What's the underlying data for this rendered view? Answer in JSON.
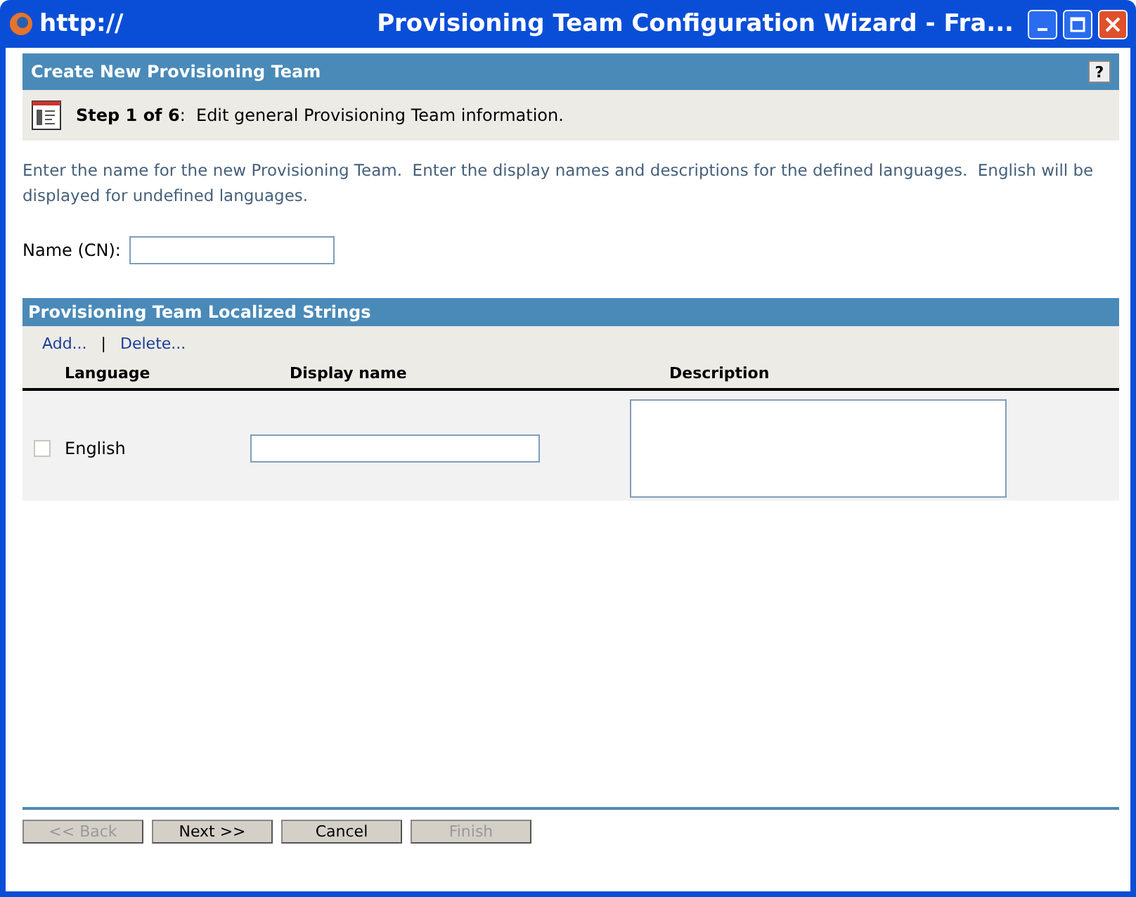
{
  "window": {
    "title_left": "http://",
    "title": "Provisioning Team Configuration Wizard - Fra..."
  },
  "panel": {
    "title": "Create New Provisioning Team",
    "help": "?"
  },
  "step": {
    "text": "**Step 1 of 6**:  Edit general Provisioning Team information."
  },
  "intro": "Enter the name for the new Provisioning Team.  Enter the display names and descriptions for the defined languages.  English will be displayed for undefined languages.",
  "name_field": {
    "label": "Name (CN):"
  },
  "strings_section": {
    "title": "Provisioning Team Localized Strings",
    "actions": [
      "Add...",
      "Delete..."
    ],
    "separator": "|",
    "columns": [
      "Language",
      "Display name",
      "Description"
    ],
    "rows": [
      {
        "checked": false,
        "language": "English"
      }
    ]
  },
  "buttons": [
    {
      "label": "<< Back",
      "disabled": true
    },
    {
      "label": "Next >>",
      "disabled": false
    },
    {
      "label": "Cancel",
      "disabled": false
    },
    {
      "label": "Finish",
      "disabled": true
    }
  ]
}
